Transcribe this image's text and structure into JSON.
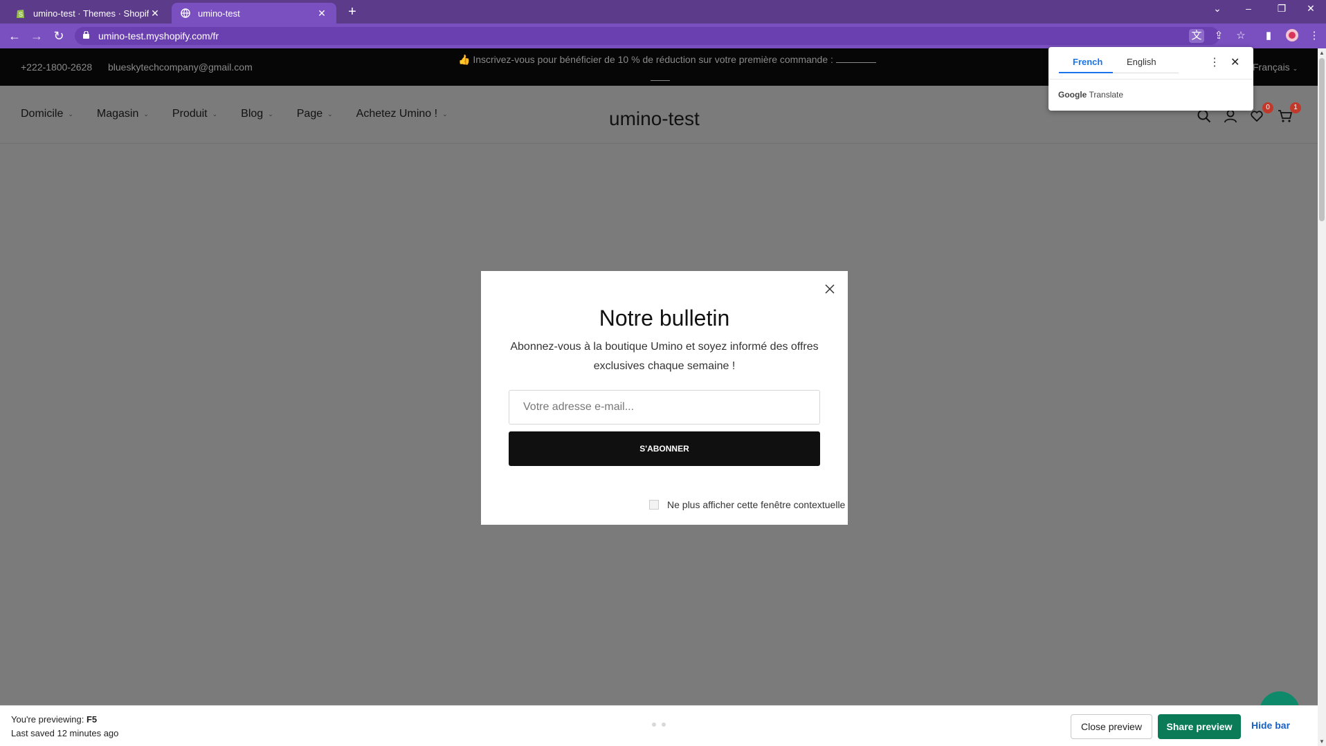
{
  "browser": {
    "tabs": [
      {
        "title": "umino-test · Themes · Shopify",
        "icon": "shopify-icon"
      },
      {
        "title": "umino-test",
        "icon": "globe-icon"
      }
    ],
    "url": "umino-test.myshopify.com/fr"
  },
  "announcement": {
    "phone": "+222-1800-2628",
    "email": "blueskytechcompany@gmail.com",
    "promo": "👍 Inscrivez-vous pour bénéficier de 10 % de réduction sur votre première commande :",
    "language": "Français"
  },
  "header": {
    "menu": [
      "Domicile",
      "Magasin",
      "Produit",
      "Blog",
      "Page",
      "Achetez Umino !"
    ],
    "logo": "umino-test",
    "wishlist_count": "0",
    "cart_count": "1"
  },
  "newsletter": {
    "title": "Notre bulletin",
    "description": "Abonnez-vous à la boutique Umino et soyez informé des offres exclusives chaque semaine !",
    "email_placeholder": "Votre adresse e-mail...",
    "subscribe_label": "S'ABONNER",
    "dont_show_label": "Ne plus afficher cette fenêtre contextuelle"
  },
  "translate": {
    "tab_french": "French",
    "tab_english": "English",
    "brand_google": "Google",
    "brand_translate": "Translate"
  },
  "preview_bar": {
    "previewing_label": "You're previewing:",
    "previewing_theme": "F5",
    "saved": "Last saved 12 minutes ago",
    "close_label": "Close preview",
    "share_label": "Share preview",
    "hide_label": "Hide bar"
  },
  "colors": {
    "browser_frame": "#7a4fc0",
    "overlay": "#7b7b7b",
    "share_button": "#0b7b57",
    "badge": "#c0392b"
  }
}
